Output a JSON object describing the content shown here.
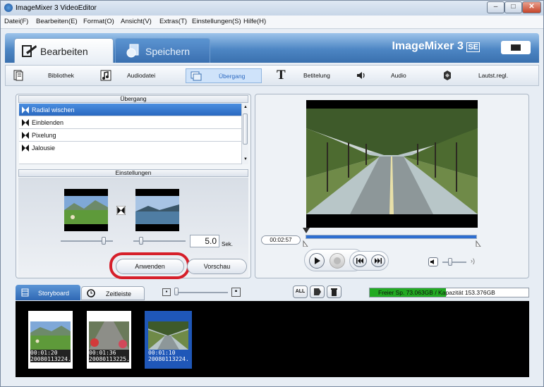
{
  "window": {
    "title": "ImageMixer 3 VideoEditor",
    "controls": [
      "–",
      "□",
      "✕"
    ]
  },
  "menu": [
    "Datei(F)",
    "Bearbeiten(E)",
    "Format(O)",
    "Ansicht(V)",
    "Extras(T)",
    "Einstellungen(S)",
    "Hilfe(H)"
  ],
  "header": {
    "tabs": [
      {
        "label": "Bearbeiten",
        "active": true
      },
      {
        "label": "Speichern",
        "active": false
      }
    ],
    "brand": "ImageMixer 3",
    "brand_suffix": "SE"
  },
  "toolbar": [
    {
      "label": "Bibliothek",
      "icon": "library-icon"
    },
    {
      "label": "Audiodatei",
      "icon": "music-note-icon"
    },
    {
      "label": "Übergang",
      "icon": "transition-icon",
      "active": true
    },
    {
      "label": "Betitelung",
      "icon": "title-text-icon"
    },
    {
      "label": "Audio",
      "icon": "speaker-icon"
    },
    {
      "label": "Lautst.regl.",
      "icon": "volume-control-icon"
    }
  ],
  "transition": {
    "header": "Übergang",
    "items": [
      {
        "label": "Radial wischen",
        "selected": true
      },
      {
        "label": "Einblenden",
        "selected": false
      },
      {
        "label": "Pixelung",
        "selected": false
      },
      {
        "label": "Jalousie",
        "selected": false
      }
    ]
  },
  "settings": {
    "header": "Einstellungen",
    "duration_value": "5.0",
    "duration_unit": "Sek.",
    "apply_label": "Anwenden",
    "preview_label": "Vorschau"
  },
  "player": {
    "timecode": "00:02:57",
    "progress": 1.0
  },
  "storyboard": {
    "tab_storyboard": "Storyboard",
    "tab_timeline": "Zeitleiste",
    "all_button": "ALL",
    "capacity_text": "Freier Sp. 73.063GB / Kapazität 153.376GB",
    "capacity_used_fraction": 0.48,
    "clips": [
      {
        "time": "00:01:20",
        "name": "20080113224...",
        "selected": false
      },
      {
        "time": "00:01:36",
        "name": "20080113225...",
        "selected": false
      },
      {
        "time": "00:01:10",
        "name": "20080113224...",
        "selected": true
      }
    ]
  },
  "colors": {
    "accent": "#2a68c0",
    "highlight_ring": "#d61f2a",
    "capacity_fill": "#22aa22"
  }
}
